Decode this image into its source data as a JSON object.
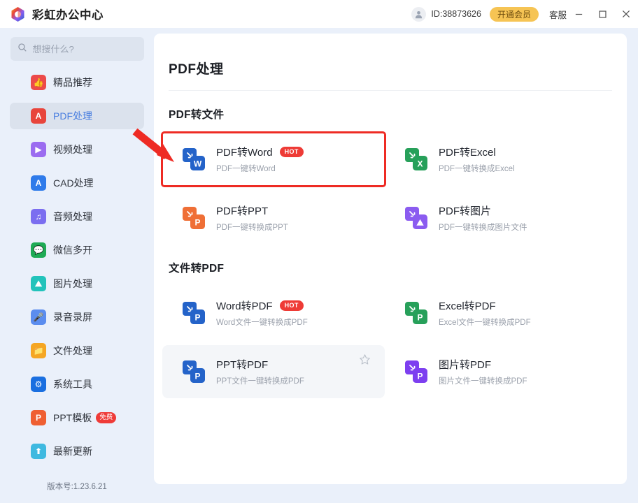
{
  "window": {
    "app_title": "彩虹办公中心",
    "logo_icon": "rainbow-hexagon-logo",
    "user_id": "ID:38873626",
    "vip_button": "开通会员",
    "support_link": "客服",
    "minimize_icon": "minimize-icon",
    "maximize_icon": "maximize-icon",
    "close_icon": "close-icon",
    "avatar_icon": "user-avatar-icon"
  },
  "sidebar": {
    "search": {
      "placeholder": "想搜什么?",
      "icon": "search-icon",
      "value": ""
    },
    "items": [
      {
        "label": "精品推荐",
        "icon": "thumbs-up-icon",
        "color": "#ec4a4a",
        "glyph": "👍",
        "active": false,
        "badge": ""
      },
      {
        "label": "PDF处理",
        "icon": "pdf-icon",
        "color": "#e8453c",
        "glyph": "A",
        "active": true,
        "badge": ""
      },
      {
        "label": "视频处理",
        "icon": "video-play-icon",
        "color": "#9b6cf0",
        "glyph": "▶",
        "active": false,
        "badge": ""
      },
      {
        "label": "CAD处理",
        "icon": "cad-icon",
        "color": "#2f7bea",
        "glyph": "A",
        "active": false,
        "badge": ""
      },
      {
        "label": "音频处理",
        "icon": "music-note-icon",
        "color": "#7b6ef0",
        "glyph": "♫",
        "active": false,
        "badge": ""
      },
      {
        "label": "微信多开",
        "icon": "wechat-icon",
        "color": "#1fab55",
        "glyph": "💬",
        "active": false,
        "badge": ""
      },
      {
        "label": "图片处理",
        "icon": "image-icon",
        "color": "#22c3bb",
        "glyph": "⛰",
        "active": false,
        "badge": ""
      },
      {
        "label": "录音录屏",
        "icon": "microphone-icon",
        "color": "#5b8def",
        "glyph": "🎤",
        "active": false,
        "badge": ""
      },
      {
        "label": "文件处理",
        "icon": "folder-icon",
        "color": "#f5a623",
        "glyph": "📁",
        "active": false,
        "badge": ""
      },
      {
        "label": "系统工具",
        "icon": "gear-icon",
        "color": "#1a6fe0",
        "glyph": "⚙",
        "active": false,
        "badge": ""
      },
      {
        "label": "PPT模板",
        "icon": "ppt-icon",
        "color": "#ef5f32",
        "glyph": "P",
        "active": false,
        "badge": "免费"
      },
      {
        "label": "最新更新",
        "icon": "upload-arrow-icon",
        "color": "#3fb9e0",
        "glyph": "⬆",
        "active": false,
        "badge": ""
      }
    ],
    "version": "版本号:1.23.6.21"
  },
  "main": {
    "page_title": "PDF处理",
    "sections": [
      {
        "heading": "PDF转文件",
        "cards": [
          {
            "title": "PDF转Word",
            "subtitle": "PDF一键转Word",
            "badge": "HOT",
            "icon": "pdf-to-word-icon",
            "color": "#2463c9",
            "glyph": "W",
            "state": "highlight",
            "star": false
          },
          {
            "title": "PDF转Excel",
            "subtitle": "PDF一键转换成Excel",
            "badge": "",
            "icon": "pdf-to-excel-icon",
            "color": "#27a05a",
            "glyph": "X",
            "state": "",
            "star": false
          },
          {
            "title": "PDF转PPT",
            "subtitle": "PDF一键转换成PPT",
            "badge": "",
            "icon": "pdf-to-ppt-icon",
            "color": "#ef6f36",
            "glyph": "P",
            "state": "",
            "star": false
          },
          {
            "title": "PDF转图片",
            "subtitle": "PDF一键转换成图片文件",
            "badge": "",
            "icon": "pdf-to-image-icon",
            "color": "#8b5cf0",
            "glyph": "⛰",
            "state": "",
            "star": false
          }
        ]
      },
      {
        "heading": "文件转PDF",
        "cards": [
          {
            "title": "Word转PDF",
            "subtitle": "Word文件一键转换成PDF",
            "badge": "HOT",
            "icon": "word-to-pdf-icon",
            "color": "#2463c9",
            "glyph": "P",
            "state": "",
            "star": false
          },
          {
            "title": "Excel转PDF",
            "subtitle": "Excel文件一键转换成PDF",
            "badge": "",
            "icon": "excel-to-pdf-icon",
            "color": "#27a05a",
            "glyph": "P",
            "state": "",
            "star": false
          },
          {
            "title": "PPT转PDF",
            "subtitle": "PPT文件一键转换成PDF",
            "badge": "",
            "icon": "ppt-to-pdf-icon",
            "color": "#2463c9",
            "glyph": "P",
            "state": "hovered",
            "star": true
          },
          {
            "title": "图片转PDF",
            "subtitle": "图片文件一键转换成PDF",
            "badge": "",
            "icon": "image-to-pdf-icon",
            "color": "#7d3ff0",
            "glyph": "P",
            "state": "",
            "star": false
          }
        ]
      }
    ]
  },
  "annotation": {
    "arrow_color": "#ee2b24",
    "arrow_icon": "red-pointer-arrow"
  },
  "colors": {
    "accent": "#4a7fe0",
    "highlight": "#ee2b24",
    "vip": "#f6c454",
    "background": "#eaf0fa"
  }
}
